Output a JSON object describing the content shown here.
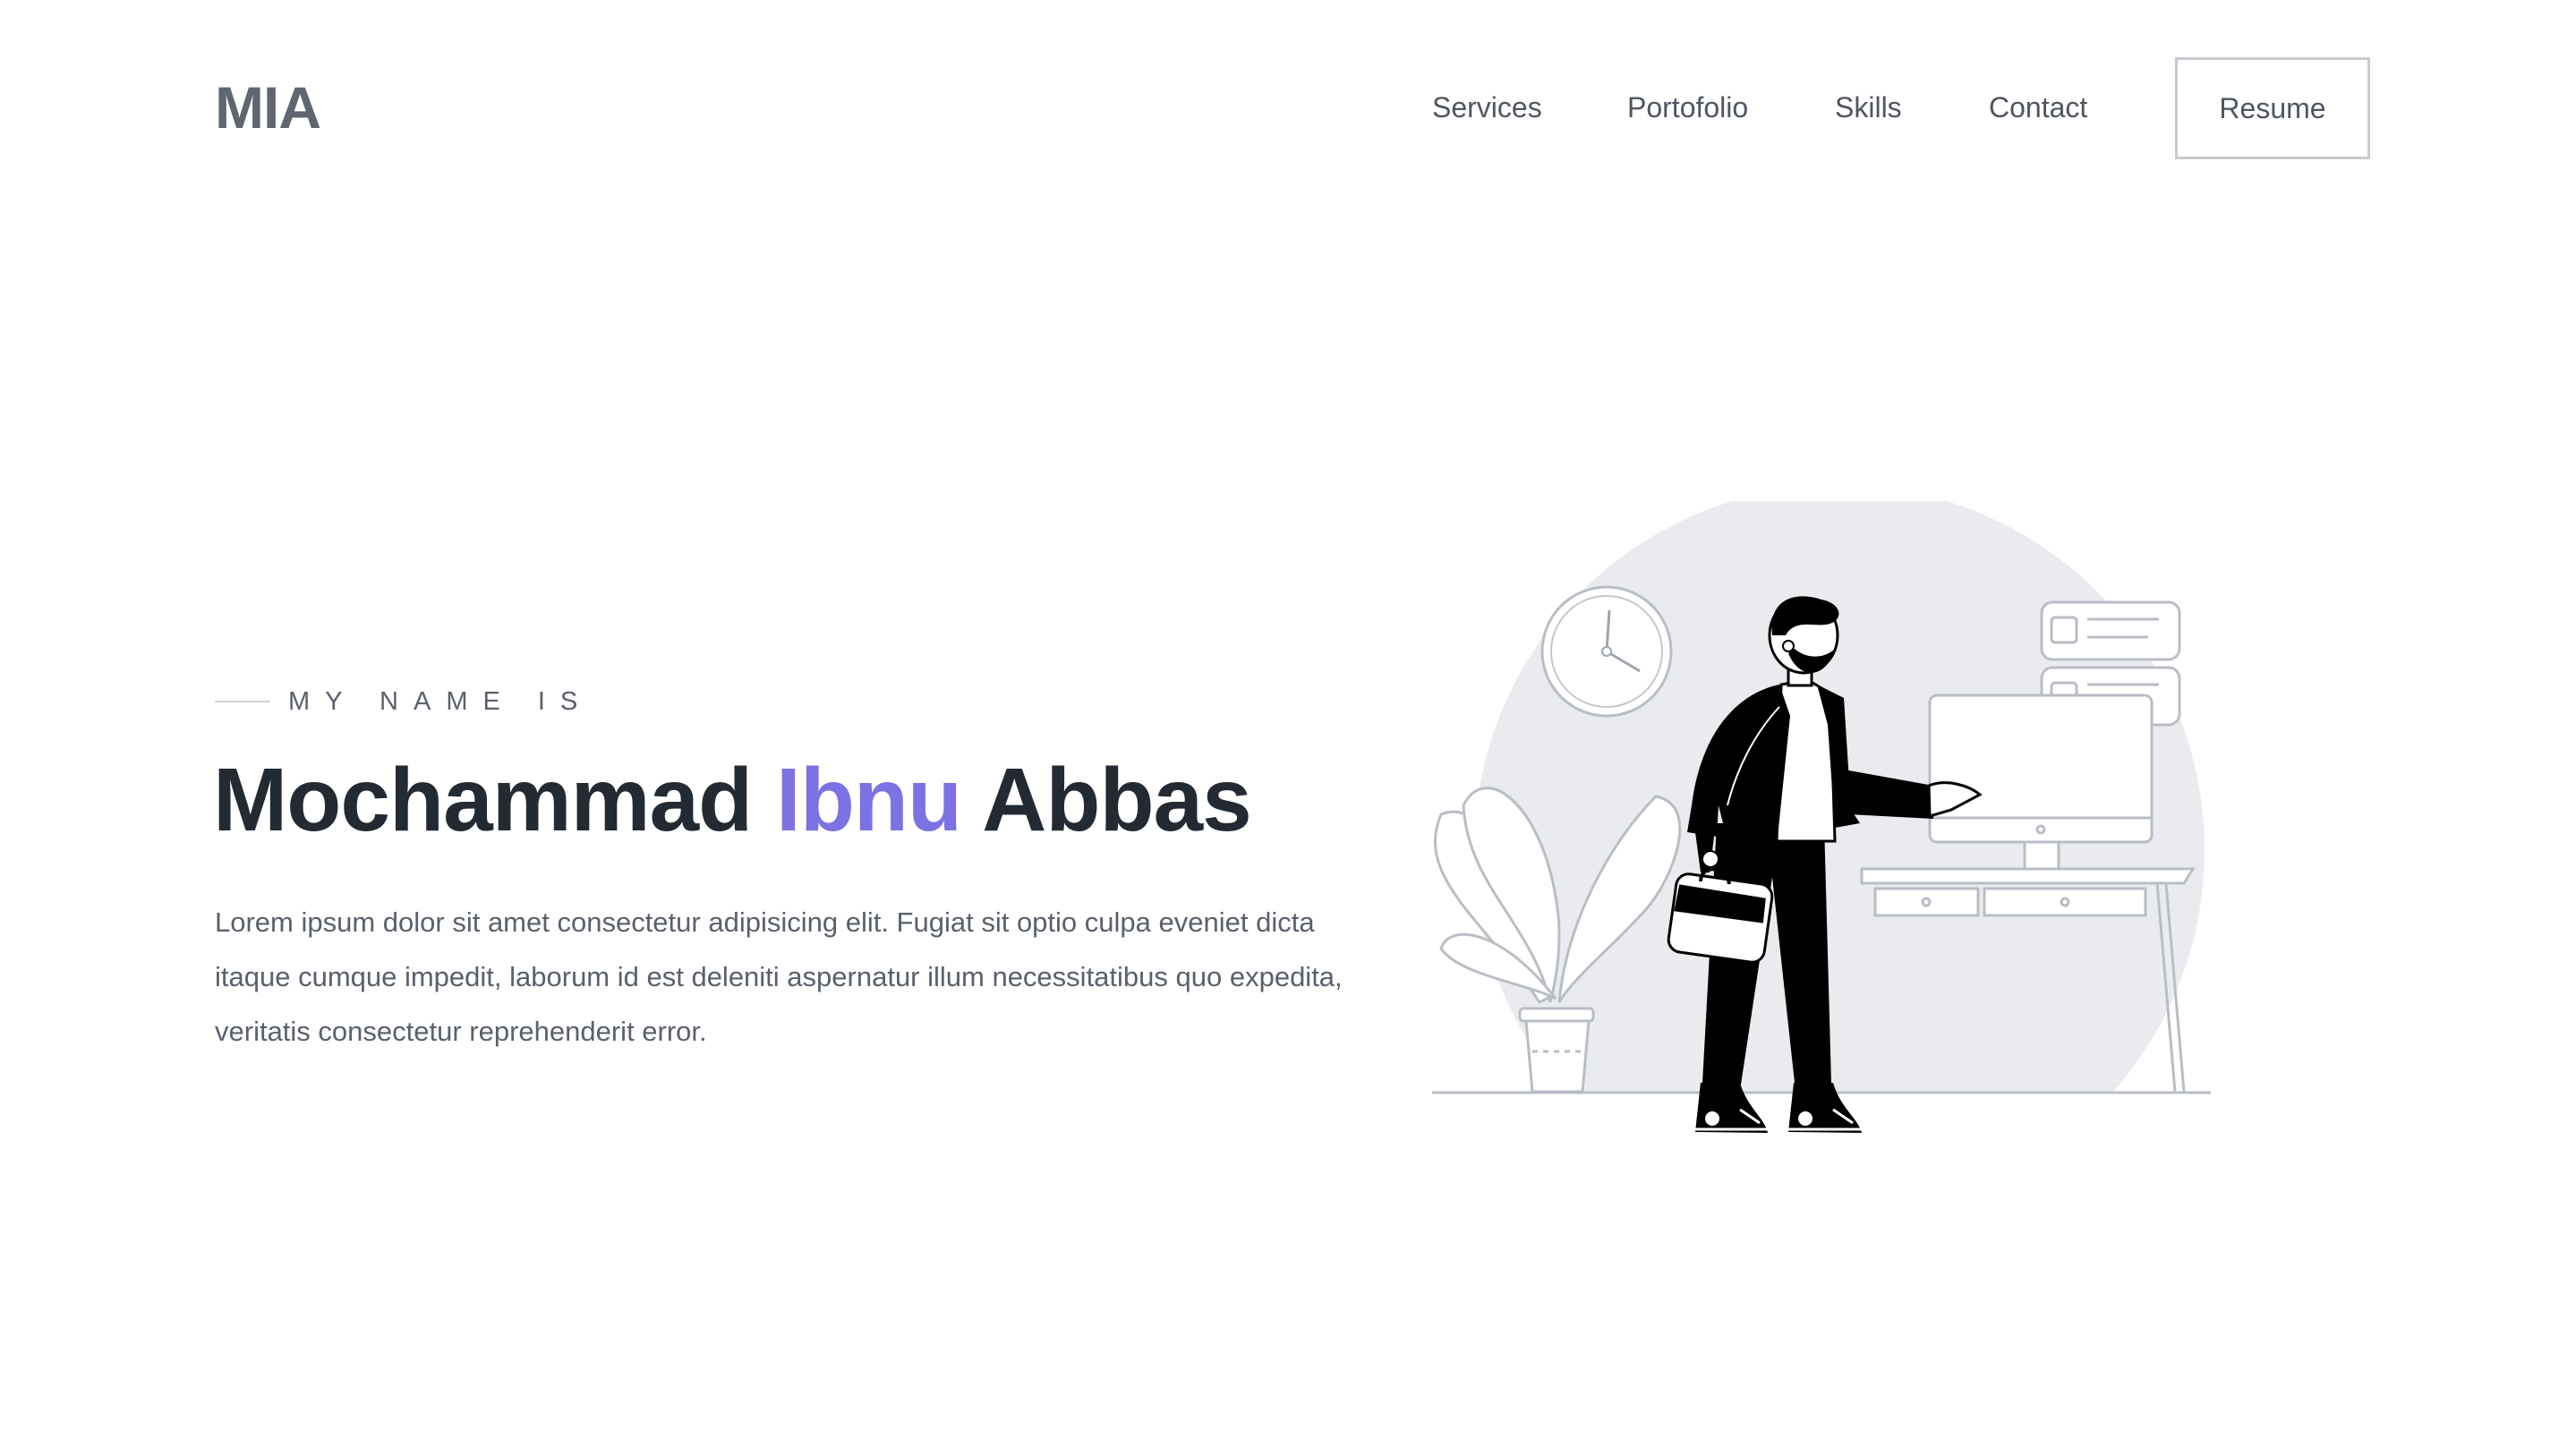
{
  "header": {
    "logo": "MIA",
    "nav": {
      "services": "Services",
      "portfolio": "Portofolio",
      "skills": "Skills",
      "contact": "Contact"
    },
    "resume_label": "Resume"
  },
  "hero": {
    "eyebrow": "MY NAME IS",
    "name_first": "Mochammad",
    "name_middle": "Ibnu",
    "name_last": "Abbas",
    "description": "Lorem ipsum dolor sit amet consectetur adipisicing elit. Fugiat sit optio culpa eveniet dicta itaque cumque impedit, laborum id est deleniti aspernatur illum necessitatibus quo expedita, veritatis consectetur reprehenderit error."
  },
  "colors": {
    "accent": "#7b72e3",
    "heading": "#232a31",
    "body_text": "#5a616b",
    "illustration_bg": "#e9ebee"
  },
  "icons": {
    "illustration": "man-with-briefcase-at-desk-illustration"
  }
}
